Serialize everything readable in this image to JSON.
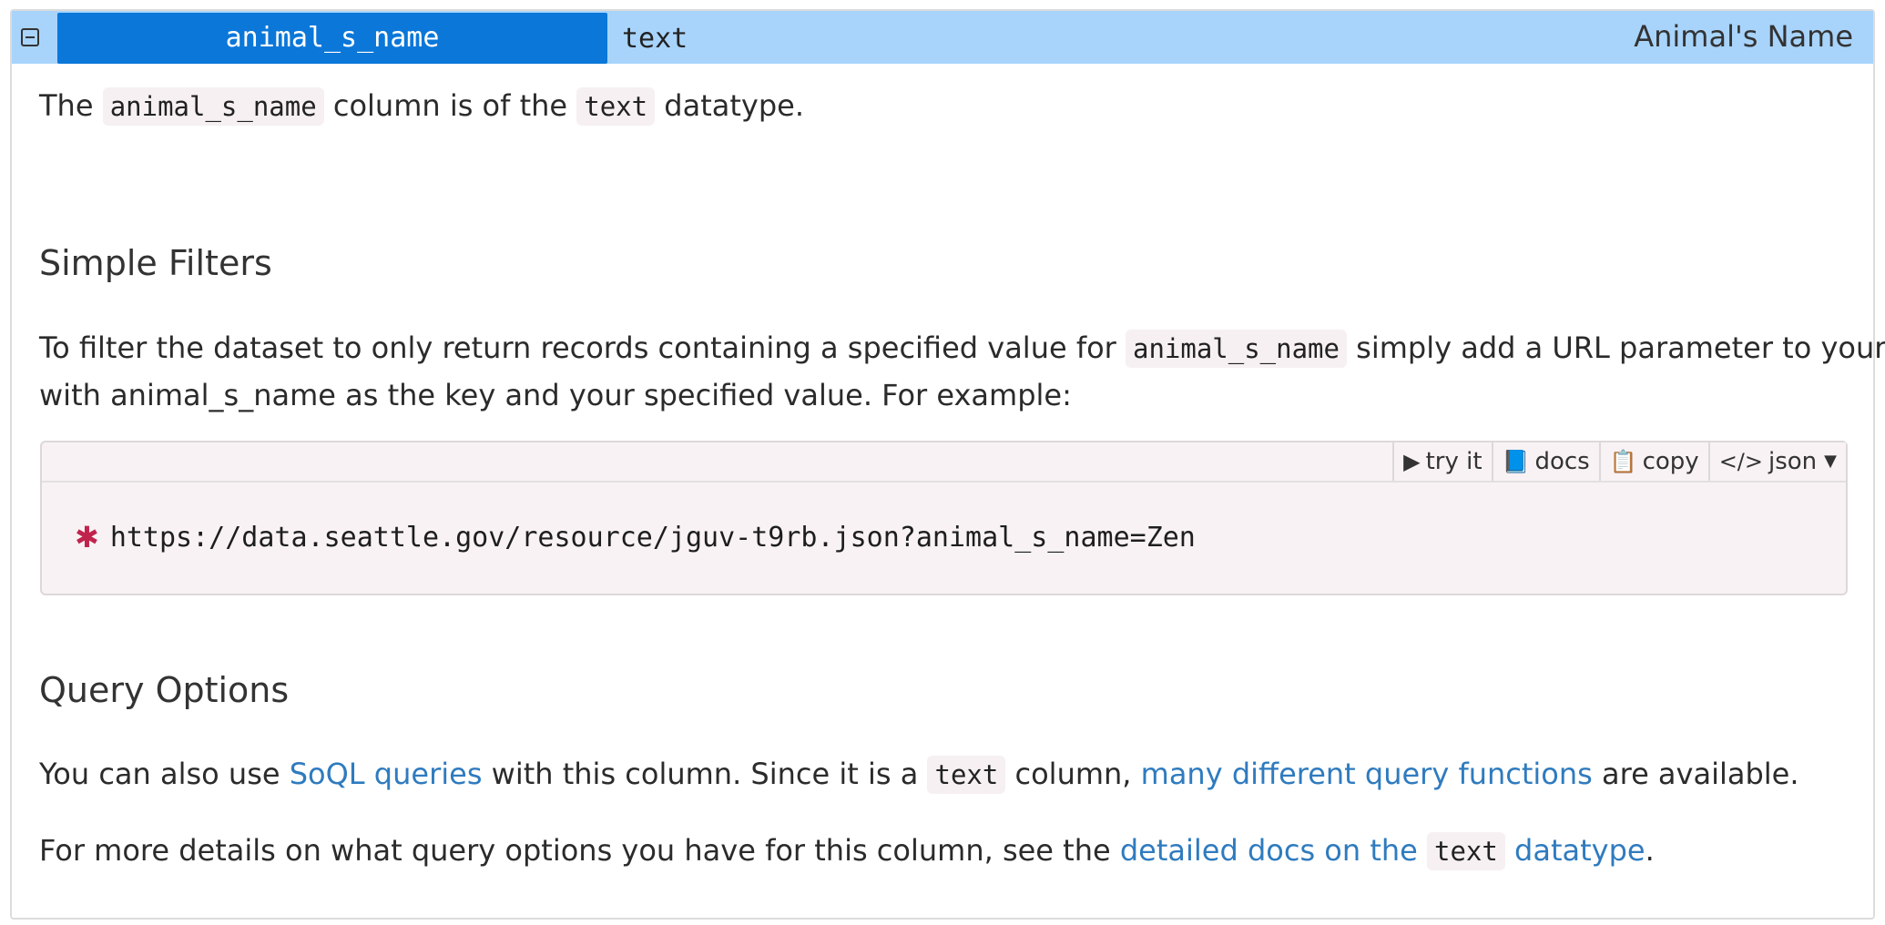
{
  "header": {
    "column_name": "animal_s_name",
    "column_type": "text",
    "column_label": "Animal's Name"
  },
  "intro": {
    "p1": "The ",
    "code1": "animal_s_name",
    "p2": " column is of the ",
    "code2": "text",
    "p3": " datatype."
  },
  "simple_filters": {
    "heading": "Simple Filters",
    "line1_a": "To filter the dataset to only return records containing a specified value for ",
    "line1_code": "animal_s_name",
    "line1_b": " simply add a URL parameter to your URL",
    "line2": "with animal_s_name as the key and your specified value. For example:"
  },
  "code_box": {
    "try_it": "try it",
    "docs": "docs",
    "copy": "copy",
    "json": "json",
    "url": "https://data.seattle.gov/resource/jguv-t9rb.json?animal_s_name=Zen"
  },
  "query_options": {
    "heading": "Query Options",
    "l1_a": "You can also use ",
    "l1_link1": "SoQL queries",
    "l1_b": " with this column. Since it is a ",
    "l1_code": "text",
    "l1_c": " column, ",
    "l1_link2": "many different query functions",
    "l1_d": " are available.",
    "l2_a": "For more details on what query options you have for this column, see the ",
    "l2_link_a": "detailed docs on the ",
    "l2_code": "text",
    "l2_link_b": " datatype",
    "l2_end": "."
  },
  "colors": {
    "header_bg": "#a8d4fc",
    "name_bg": "#0b77d9",
    "link": "#2f7bbf",
    "gear": "#c0244d"
  },
  "icons": {
    "collapse": "minus-square-icon",
    "try_it": "play-icon",
    "docs": "book-icon",
    "copy": "clipboard-icon",
    "json": "code-icon",
    "dropdown": "caret-down-icon",
    "url": "gear-icon"
  }
}
